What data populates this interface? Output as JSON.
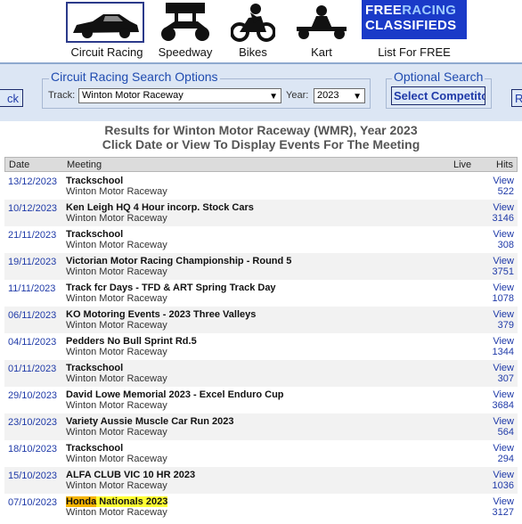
{
  "nav": {
    "categories": [
      {
        "label": "Circuit Racing",
        "icon": "race-car-icon",
        "selected": true
      },
      {
        "label": "Speedway",
        "icon": "sprint-car-icon",
        "selected": false
      },
      {
        "label": "Bikes",
        "icon": "motorbike-icon",
        "selected": false
      },
      {
        "label": "Kart",
        "icon": "kart-icon",
        "selected": false
      }
    ],
    "classifieds": {
      "line1_a": "FREE",
      "line1_b": "RACING",
      "line2": "CLASSIFIEDS",
      "label": "List For FREE"
    }
  },
  "search": {
    "back_label": "ck",
    "right_label": "R",
    "title": "Circuit Racing Search Options",
    "track_label": "Track:",
    "track_value": "Winton Motor Raceway",
    "year_label": "Year:",
    "year_value": "2023",
    "optional_title": "Optional Search",
    "competitor_label": "Select Competito"
  },
  "results": {
    "line1": "Results for Winton Motor Raceway (WMR), Year 2023",
    "line2": "Click Date or View To Display Events For The Meeting"
  },
  "table": {
    "headers": {
      "date": "Date",
      "meeting": "Meeting",
      "live": "Live",
      "hits": "Hits"
    },
    "rows": [
      {
        "date": "13/12/2023",
        "title": "Trackschool",
        "venue": "Winton Motor Raceway",
        "view": "View",
        "hits": "522"
      },
      {
        "date": "10/12/2023",
        "title": "Ken Leigh HQ 4 Hour incorp. Stock Cars",
        "venue": "Winton Motor Raceway",
        "view": "View",
        "hits": "3146"
      },
      {
        "date": "21/11/2023",
        "title": "Trackschool",
        "venue": "Winton Motor Raceway",
        "view": "View",
        "hits": "308"
      },
      {
        "date": "19/11/2023",
        "title": "Victorian Motor Racing Championship - Round 5",
        "venue": "Winton Motor Raceway",
        "view": "View",
        "hits": "3751"
      },
      {
        "date": "11/11/2023",
        "title": "Track fcr Days - TFD & ART Spring Track Day",
        "venue": "Winton Motor Raceway",
        "view": "View",
        "hits": "1078"
      },
      {
        "date": "06/11/2023",
        "title": "KO Motoring Events - 2023 Three Valleys",
        "venue": "Winton Motor Raceway",
        "view": "View",
        "hits": "379"
      },
      {
        "date": "04/11/2023",
        "title": "Pedders No Bull Sprint Rd.5",
        "venue": "Winton Motor Raceway",
        "view": "View",
        "hits": "1344"
      },
      {
        "date": "01/11/2023",
        "title": "Trackschool",
        "venue": "Winton Motor Raceway",
        "view": "View",
        "hits": "307"
      },
      {
        "date": "29/10/2023",
        "title": "David Lowe Memorial 2023 - Excel Enduro Cup",
        "venue": "Winton Motor Raceway",
        "view": "View",
        "hits": "3684"
      },
      {
        "date": "23/10/2023",
        "title": "Variety Aussie Muscle Car Run 2023",
        "venue": "Winton Motor Raceway",
        "view": "View",
        "hits": "564"
      },
      {
        "date": "18/10/2023",
        "title": "Trackschool",
        "venue": "Winton Motor Raceway",
        "view": "View",
        "hits": "294"
      },
      {
        "date": "15/10/2023",
        "title": "ALFA CLUB VIC 10 HR 2023",
        "venue": "Winton Motor Raceway",
        "view": "View",
        "hits": "1036"
      },
      {
        "date": "07/10/2023",
        "title_a": "Honda",
        "title_b": " Nationals 2023",
        "venue": "Winton Motor Raceway",
        "view": "View",
        "hits": "3127"
      }
    ]
  }
}
